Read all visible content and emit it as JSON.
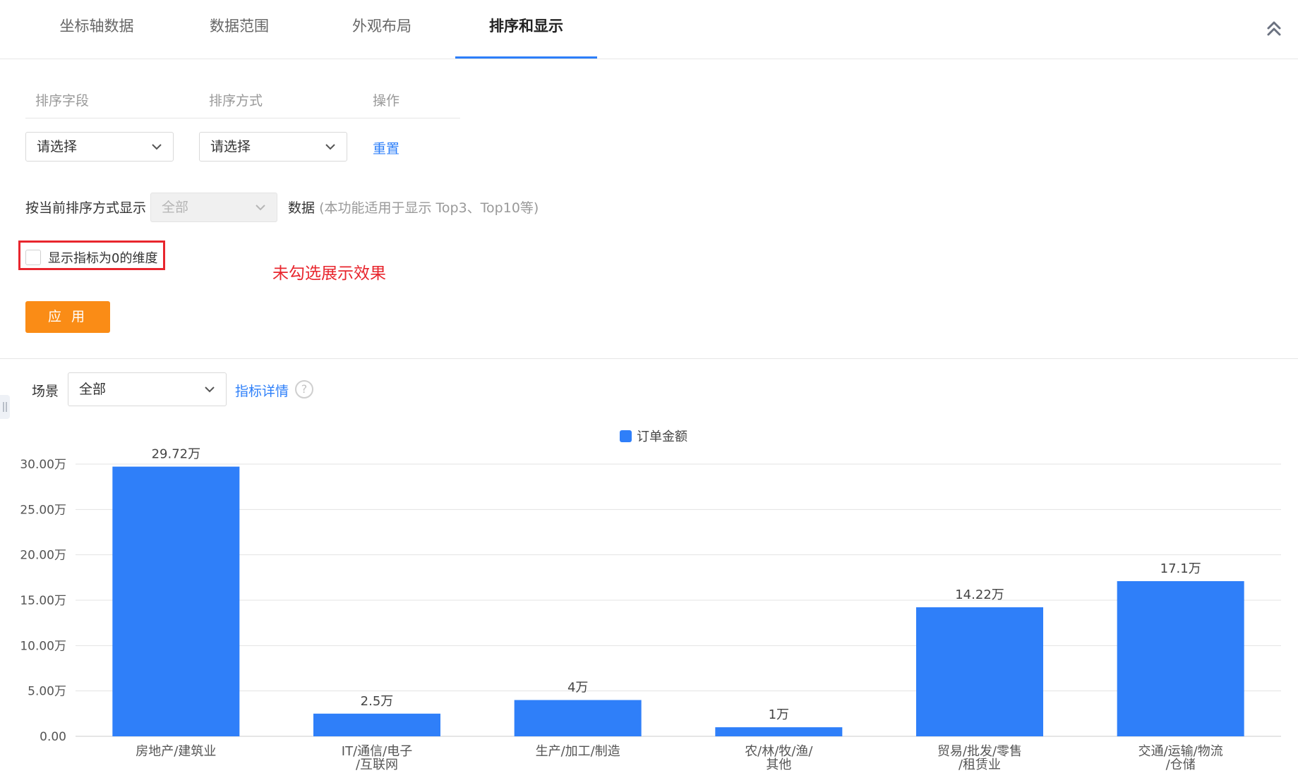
{
  "tabs": [
    {
      "label": "坐标轴数据"
    },
    {
      "label": "数据范围"
    },
    {
      "label": "外观布局"
    },
    {
      "label": "排序和显示"
    }
  ],
  "active_tab": 3,
  "sort_table": {
    "headers": [
      "排序字段",
      "排序方式",
      "操作"
    ],
    "field_select": "请选择",
    "order_select": "请选择",
    "reset_link": "重置"
  },
  "display": {
    "prefix": "按当前排序方式显示",
    "select_value": "全部",
    "suffix": "数据",
    "hint": "(本功能适用于显示 Top3、Top10等)"
  },
  "zero_dimension": {
    "label": "显示指标为0的维度",
    "checked": false
  },
  "annotation": "未勾选展示效果",
  "apply_button": "应 用",
  "scene": {
    "label": "场景",
    "value": "全部",
    "detail_link": "指标详情",
    "help_glyph": "?"
  },
  "colors": {
    "accent": "#2d7ff9",
    "bar": "#2f7ff9",
    "apply": "#fa8c16",
    "warn": "#e8262e"
  },
  "chart_data": {
    "type": "bar",
    "categories": [
      [
        "房地产/建筑业"
      ],
      [
        "IT/通信/电子",
        "/互联网"
      ],
      [
        "生产/加工/制造"
      ],
      [
        "农/林/牧/渔/",
        "其他"
      ],
      [
        "贸易/批发/零售",
        "/租赁业"
      ],
      [
        "交通/运输/物流",
        "/仓储"
      ]
    ],
    "series": [
      {
        "name": "订单金额",
        "values": [
          29.72,
          2.5,
          4,
          1,
          14.22,
          17.1
        ]
      }
    ],
    "data_labels": [
      "29.72万",
      "2.5万",
      "4万",
      "1万",
      "14.22万",
      "17.1万"
    ],
    "ylim": [
      0,
      30
    ],
    "yticks": [
      {
        "value": 0,
        "label": "0.00"
      },
      {
        "value": 5,
        "label": "5.00万"
      },
      {
        "value": 10,
        "label": "10.00万"
      },
      {
        "value": 15,
        "label": "15.00万"
      },
      {
        "value": 20,
        "label": "20.00万"
      },
      {
        "value": 25,
        "label": "25.00万"
      },
      {
        "value": 30,
        "label": "30.00万"
      }
    ],
    "grid": true,
    "legend_position": "top-center"
  }
}
